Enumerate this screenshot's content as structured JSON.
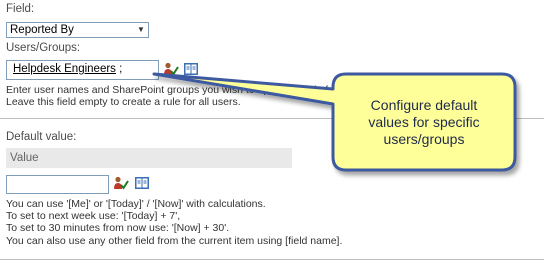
{
  "field": {
    "label": "Field:",
    "selected": "Reported By"
  },
  "users_groups": {
    "label": "Users/Groups:",
    "value": "Helpdesk Engineers",
    "separator": " ;",
    "desc_line1": "Enter user names and SharePoint groups you wish to apply this rule for.",
    "desc_line2": "Leave this field empty to create a rule for all users."
  },
  "default_value": {
    "label": "Default value:",
    "header": "Value",
    "input_value": "",
    "help_line1": "You can use '[Me]' or '[Today]' / '[Now]' with calculations.",
    "help_line2": "To set to next week use: '[Today] + 7',",
    "help_line3": "To set to 30 minutes from now use: '[Now] + 30'.",
    "help_line4": " You can also use any other field from the current item using [field name]."
  },
  "callout": {
    "line1": "Configure default",
    "line2": "values for specific",
    "line3": "users/groups",
    "fill": "#ffff99",
    "border": "#3c5aa0"
  },
  "icons": {
    "check_names": "check-names-icon",
    "browse": "address-book-icon"
  }
}
